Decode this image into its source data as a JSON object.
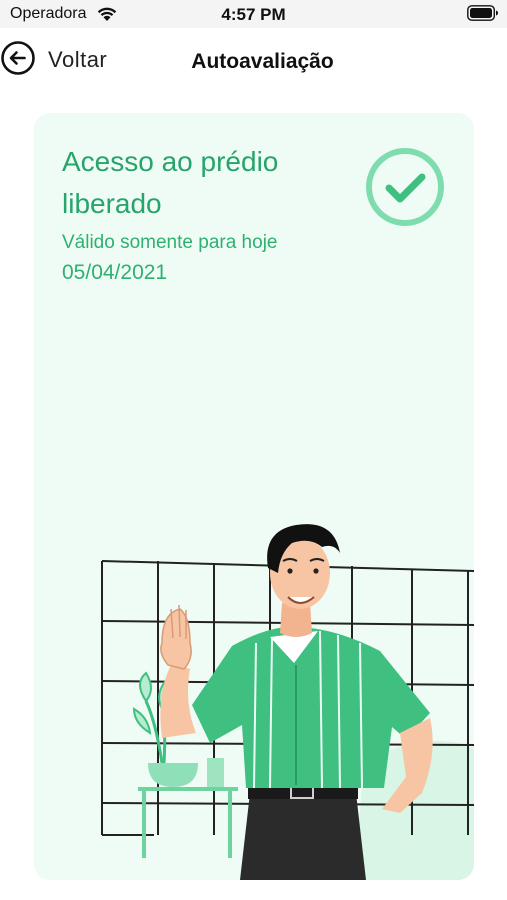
{
  "status_bar": {
    "carrier": "Operadora",
    "time": "4:57 PM"
  },
  "nav": {
    "back_label": "Voltar",
    "title": "Autoavaliação"
  },
  "card": {
    "title": "Acesso ao prédio liberado",
    "subtitle": "Válido somente para hoje",
    "date": "05/04/2021"
  },
  "colors": {
    "accent": "#27a46b",
    "card_background": "#effcf5",
    "shirt": "#3fbf80"
  },
  "icons": {
    "back": "arrow-left-circle-icon",
    "status": "check-circle-icon"
  }
}
